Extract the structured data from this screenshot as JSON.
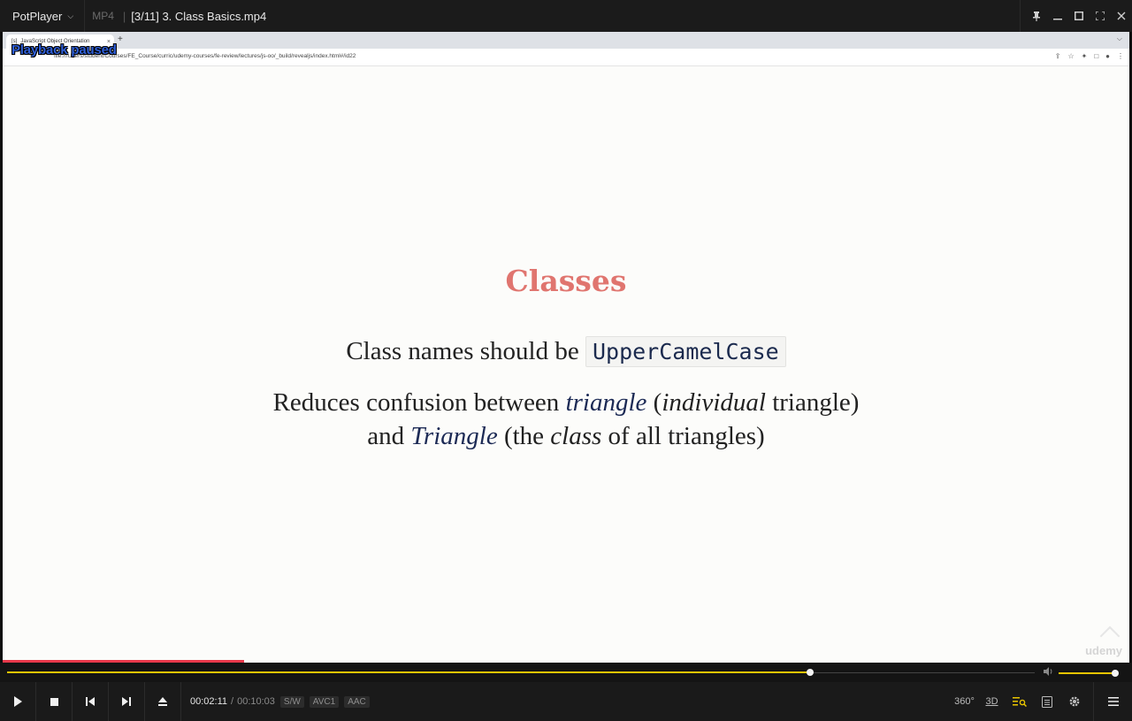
{
  "titlebar": {
    "app_name": "PotPlayer",
    "format": "MP4",
    "file_title": "[3/11] 3. Class Basics.mp4"
  },
  "browser": {
    "tab_title": "JavaScript Object Orientation",
    "tab_close": "×",
    "new_tab": "+",
    "url": "file:///Users/student/Courses/FE_Course/curric/udemy-courses/fe-review/lectures/js-oo/_build/revealjs/index.html#/id22"
  },
  "osd": {
    "status": "Playback paused"
  },
  "slide": {
    "title": "Classes",
    "line1_text": "Class names should be ",
    "line1_code": "UpperCamelCase",
    "line2_a": "Reduces confusion between ",
    "line2_b": "triangle",
    "line2_c": " (",
    "line2_d": "individual",
    "line2_e": " triangle)",
    "line3_a": "and ",
    "line3_b": "Triangle",
    "line3_c": " (the ",
    "line3_d": "class",
    "line3_e": " of all triangles)",
    "watermark": "udemy"
  },
  "player": {
    "current_time": "00:02:11",
    "separator": "/",
    "total_time": "00:10:03",
    "badges": [
      "S/W",
      "AVC1",
      "AAC"
    ],
    "seek_fraction": 0.7812,
    "volume_fraction": 1.0,
    "slide_progress_fraction": 0.2143,
    "right_buttons": {
      "vr": "360°",
      "stereo": "3D"
    }
  },
  "colors": {
    "accent": "#e8c400",
    "slide_title": "#e0756f",
    "slide_progress": "#e8394b",
    "osd": "#2f5fd7"
  }
}
